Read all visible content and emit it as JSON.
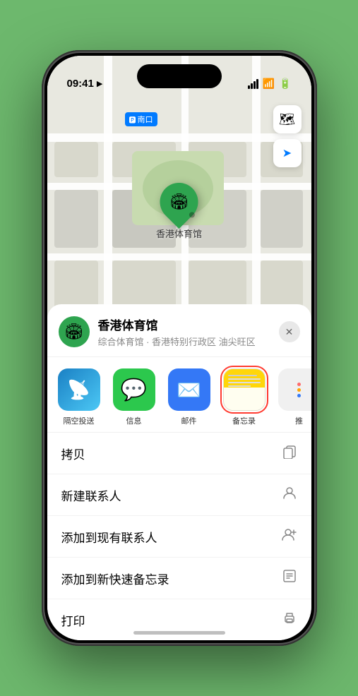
{
  "status_bar": {
    "time": "09:41",
    "location_icon": "▶"
  },
  "map": {
    "label_text": "南口",
    "marker_label": "香港体育馆",
    "controls": {
      "map_icon": "🗺",
      "location_icon": "➤"
    }
  },
  "location_card": {
    "name": "香港体育馆",
    "description": "综合体育馆 · 香港特别行政区 油尖旺区",
    "close_label": "✕"
  },
  "share_items": [
    {
      "id": "airdrop",
      "label": "隔空投送",
      "type": "airdrop"
    },
    {
      "id": "messages",
      "label": "信息",
      "type": "messages"
    },
    {
      "id": "mail",
      "label": "邮件",
      "type": "mail"
    },
    {
      "id": "notes",
      "label": "备忘录",
      "type": "notes",
      "selected": true
    },
    {
      "id": "more",
      "label": "推",
      "type": "more"
    }
  ],
  "action_items": [
    {
      "label": "拷贝",
      "icon": "copy"
    },
    {
      "label": "新建联系人",
      "icon": "person"
    },
    {
      "label": "添加到现有联系人",
      "icon": "person-add"
    },
    {
      "label": "添加到新快速备忘录",
      "icon": "note"
    },
    {
      "label": "打印",
      "icon": "print"
    }
  ]
}
